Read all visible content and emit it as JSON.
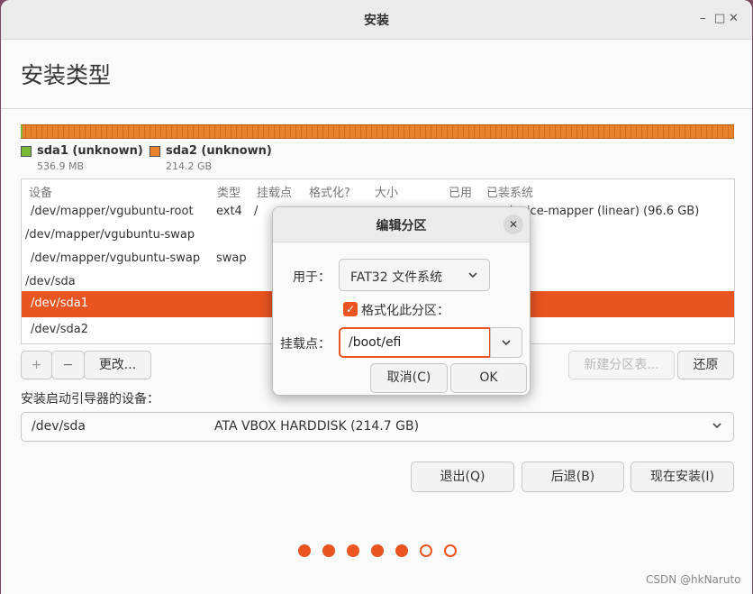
{
  "window": {
    "title": "安装",
    "minimize": "–",
    "maximize": "□",
    "close": "✕"
  },
  "page": {
    "heading": "安装类型"
  },
  "partitions_legend": [
    {
      "name": "sda1 (unknown)",
      "size": "536.9 MB",
      "color": "#7ab83a"
    },
    {
      "name": "sda2 (unknown)",
      "size": "214.2 GB",
      "color": "#e8832d"
    }
  ],
  "table": {
    "headers": [
      "设备",
      "类型",
      "挂载点",
      "格式化?",
      "大小",
      "已用",
      "已装系统"
    ],
    "rows": [
      {
        "device": "/dev/mapper/vgubuntu-root",
        "type": "ext4",
        "mount": "/",
        "system": "device-mapper (linear) (96.6 GB)"
      },
      {
        "device": "/dev/mapper/vgubuntu-swap",
        "type": "",
        "mount": "",
        "system": ""
      },
      {
        "device": "/dev/mapper/vgubuntu-swap",
        "type": "swap",
        "mount": "",
        "system": ""
      },
      {
        "device": "/dev/sda",
        "type": "",
        "mount": "",
        "system": ""
      },
      {
        "device": "/dev/sda1",
        "type": "",
        "mount": "",
        "system": ""
      },
      {
        "device": "/dev/sda2",
        "type": "",
        "mount": "",
        "system": ""
      }
    ]
  },
  "table_buttons": {
    "add": "+",
    "remove": "−",
    "change": "更改...",
    "new_table": "新建分区表...",
    "revert": "还原"
  },
  "bootloader": {
    "label": "安装启动引导器的设备：",
    "device": "/dev/sda",
    "description": "ATA VBOX HARDDISK (214.7 GB)"
  },
  "nav_buttons": {
    "quit": "退出(Q)",
    "back": "后退(B)",
    "install": "现在安装(I)"
  },
  "progress": {
    "current": 5,
    "total": 7
  },
  "watermark": "CSDN @hkNaruto",
  "dialog": {
    "title": "编辑分区",
    "use_label": "用于：",
    "use_value": "FAT32 文件系统",
    "format_label": "格式化此分区：",
    "format_checked": true,
    "mount_label": "挂载点：",
    "mount_value": "/boot/efi",
    "cancel": "取消(C)",
    "ok": "OK"
  },
  "colors": {
    "accent": "#e95420",
    "partition_bar": "#e8832d"
  }
}
